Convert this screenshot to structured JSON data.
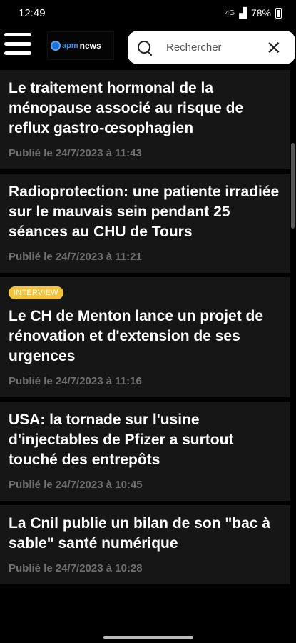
{
  "status": {
    "time": "12:49",
    "signal": "4G",
    "battery": "78%"
  },
  "header": {
    "logo_prefix": "apm",
    "logo_suffix": "news"
  },
  "search": {
    "placeholder": "Rechercher"
  },
  "articles": [
    {
      "title": "Le traitement hormonal de la ménopause associé au risque de reflux gastro-œsophagien",
      "date": "Publié le 24/7/2023 à 11:43"
    },
    {
      "title": "Radioprotection: une patiente irradiée sur le mauvais sein pendant 25 séances au CHU de Tours",
      "date": "Publié le 24/7/2023 à 11:21"
    },
    {
      "badge": "INTERVIEW",
      "title": "Le CH de Menton lance un projet de rénovation et d'extension de ses urgences",
      "date": "Publié le 24/7/2023 à 11:16"
    },
    {
      "title": "USA: la tornade sur l'usine d'injectables de Pfizer a surtout touché des entrepôts",
      "date": "Publié le 24/7/2023 à 10:45"
    },
    {
      "title": "La Cnil publie un bilan de son \"bac à sable\" santé numérique",
      "date": "Publié le 24/7/2023 à 10:28"
    }
  ],
  "colors": {
    "background": "#000000",
    "card": "#161616",
    "date": "#6f6f6f",
    "badge": "#f3c33a",
    "logo_blue": "#1e6fd6"
  }
}
